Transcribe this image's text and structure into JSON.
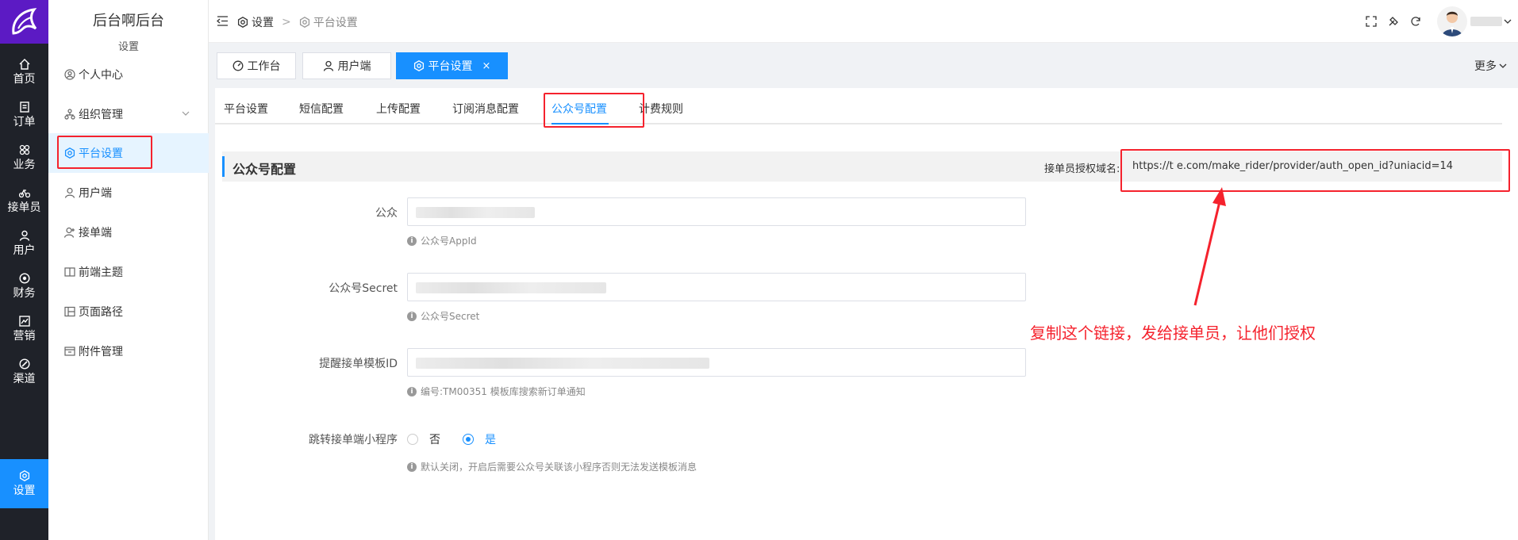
{
  "rail": {
    "items": [
      {
        "label": "首页",
        "icon": "home-icon"
      },
      {
        "label": "订单",
        "icon": "order-icon"
      },
      {
        "label": "业务",
        "icon": "business-icon"
      },
      {
        "label": "接单员",
        "icon": "bike-icon"
      },
      {
        "label": "用户",
        "icon": "user-icon"
      },
      {
        "label": "财务",
        "icon": "finance-icon"
      },
      {
        "label": "营销",
        "icon": "chart-icon"
      },
      {
        "label": "渠道",
        "icon": "channel-icon"
      },
      {
        "label": "设置",
        "icon": "gear-icon",
        "active": true
      }
    ]
  },
  "sidebar": {
    "title": "后台啊后台",
    "caption": "设置",
    "items": [
      {
        "label": "个人中心",
        "icon": "user-circle-icon"
      },
      {
        "label": "组织管理",
        "icon": "org-icon"
      },
      {
        "label": "平台设置",
        "icon": "gear-icon",
        "active": true
      },
      {
        "label": "用户端",
        "icon": "user-icon"
      },
      {
        "label": "接单端",
        "icon": "user-plus-icon"
      },
      {
        "label": "前端主题",
        "icon": "book-icon"
      },
      {
        "label": "页面路径",
        "icon": "layout-icon"
      },
      {
        "label": "附件管理",
        "icon": "attachment-icon"
      }
    ]
  },
  "header": {
    "breadcrumb": [
      "设置",
      "平台设置"
    ],
    "separator": ">"
  },
  "page_tabs": [
    {
      "label": "工作台",
      "icon": "dashboard-icon"
    },
    {
      "label": "用户端",
      "icon": "user-icon"
    },
    {
      "label": "平台设置",
      "icon": "gear-icon",
      "active": true,
      "close": "×"
    }
  ],
  "more_label": "更多",
  "settings_tabs": [
    "平台设置",
    "短信配置",
    "上传配置",
    "订阅消息配置",
    "公众号配置",
    "计费规则"
  ],
  "active_settings_tab": "公众号配置",
  "section": {
    "title": "公众号配置",
    "domain_label": "接单员授权域名:",
    "domain_value": "https://t                  e.com/make_rider/provider/auth_open_id?uniacid=14"
  },
  "form": {
    "appid_label": "公众",
    "appid_help": "公众号AppId",
    "secret_label": "公众号Secret",
    "secret_help": "公众号Secret",
    "template_label": "提醒接单模板ID",
    "template_help": "编号:TM00351 模板库搜索新订单通知",
    "jump_label": "跳转接单端小程序",
    "jump_options": [
      "否",
      "是"
    ],
    "jump_selected": "是",
    "jump_help": "默认关闭，开启后需要公众号关联该小程序否则无法发送模板消息"
  },
  "annotation": "复制这个链接，发给接单员，让他们授权",
  "colors": {
    "accent": "#1890ff",
    "annotation": "#f5222d",
    "rail": "#1f2229",
    "logo": "#5c1ac4"
  }
}
